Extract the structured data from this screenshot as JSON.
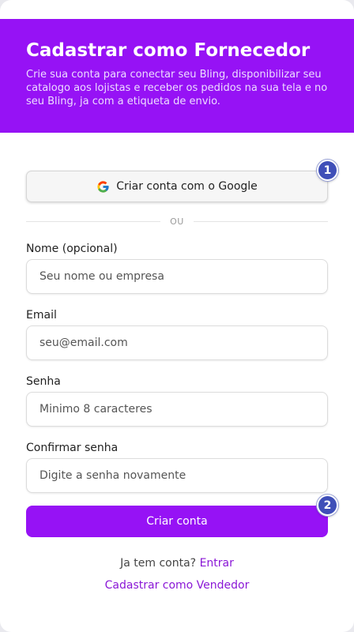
{
  "header": {
    "title": "Cadastrar como Fornecedor",
    "description": "Crie sua conta para conectar seu Bling, disponibilizar seu catalogo aos lojistas e receber os pedidos na sua tela e no seu Bling, ja com a etiqueta de envio."
  },
  "google_button": {
    "label": "Criar conta com o Google",
    "icon": "google-icon"
  },
  "divider": {
    "text": "OU"
  },
  "form": {
    "name": {
      "label": "Nome (opcional)",
      "placeholder": "Seu nome ou empresa"
    },
    "email": {
      "label": "Email",
      "placeholder": "seu@email.com"
    },
    "password": {
      "label": "Senha",
      "placeholder": "Minimo 8 caracteres"
    },
    "confirm": {
      "label": "Confirmar senha",
      "placeholder": "Digite a senha novamente"
    },
    "submit_label": "Criar conta"
  },
  "badges": {
    "first": "1",
    "second": "2"
  },
  "footer": {
    "has_account": "Ja tem conta?",
    "login_link": "Entrar",
    "vendor_link": "Cadastrar como Vendedor"
  },
  "colors": {
    "brand": "#9612f5",
    "badge": "#3f4fb8",
    "link": "#8a17d6"
  }
}
